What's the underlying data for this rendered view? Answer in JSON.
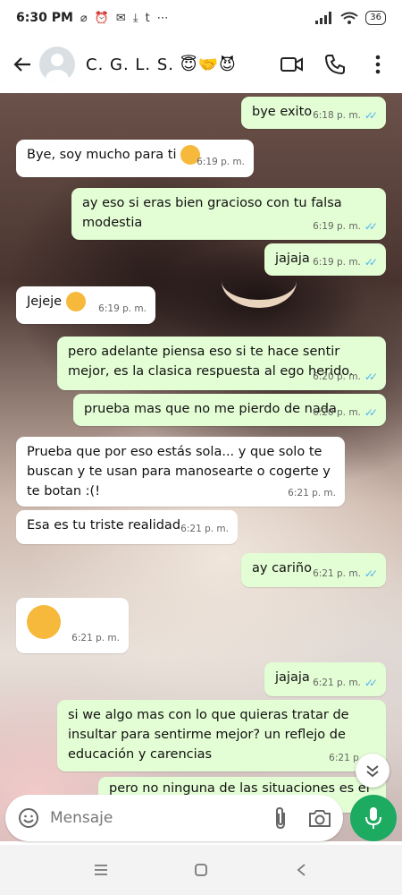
{
  "status_bar": {
    "time": "6:30 PM",
    "battery": "36"
  },
  "header": {
    "contact_name": "C. G. L. S."
  },
  "messages": [
    {
      "text": "bye exito",
      "time": "6:18 p. m."
    },
    {
      "text": "Bye, soy mucho para ti",
      "time": "6:19 p. m."
    },
    {
      "text": "ay eso si eras bien gracioso con tu falsa modestia",
      "time": "6:19 p. m."
    },
    {
      "text": "jajaja",
      "time": "6:19 p. m."
    },
    {
      "text": "Jejeje",
      "time": "6:19 p. m."
    },
    {
      "text": "pero adelante piensa eso si te hace sentir mejor, es la clasica respuesta al ego herido.",
      "time": "6:20 p. m."
    },
    {
      "text": "prueba mas que no me pierdo de nada",
      "time": "6:20 p. m."
    },
    {
      "text": "Prueba que por eso estás sola... y que solo te buscan y te usan para manosearte o cogerte y te botan :(!",
      "time": "6:21 p. m."
    },
    {
      "text": "Esa es tu triste realidad",
      "time": "6:21 p. m."
    },
    {
      "text": "ay cariño",
      "time": "6:21 p. m."
    },
    {
      "text": "",
      "time": "6:21 p. m."
    },
    {
      "text": "jajaja",
      "time": "6:21 p. m."
    },
    {
      "text": "si we algo mas con lo que quieras tratar de insultar para sentirme mejor? un reflejo de educación y carencias",
      "time": "6:21 p. m."
    },
    {
      "text": "pero no ninguna de las situaciones es el caso",
      "time": ""
    }
  ],
  "input": {
    "placeholder": "Mensaje"
  },
  "colors": {
    "outgoing_bubble": "#e3fdd4",
    "incoming_bubble": "#ffffff",
    "read_ticks": "#4fb6ec",
    "mic_button": "#1daa61"
  },
  "icons": [
    "back-arrow-icon",
    "avatar-icon",
    "video-call-icon",
    "phone-icon",
    "more-options-icon",
    "emoji-icon",
    "attach-icon",
    "camera-icon",
    "mic-icon",
    "scroll-down-icon",
    "recents-icon",
    "home-icon",
    "back-nav-icon"
  ]
}
